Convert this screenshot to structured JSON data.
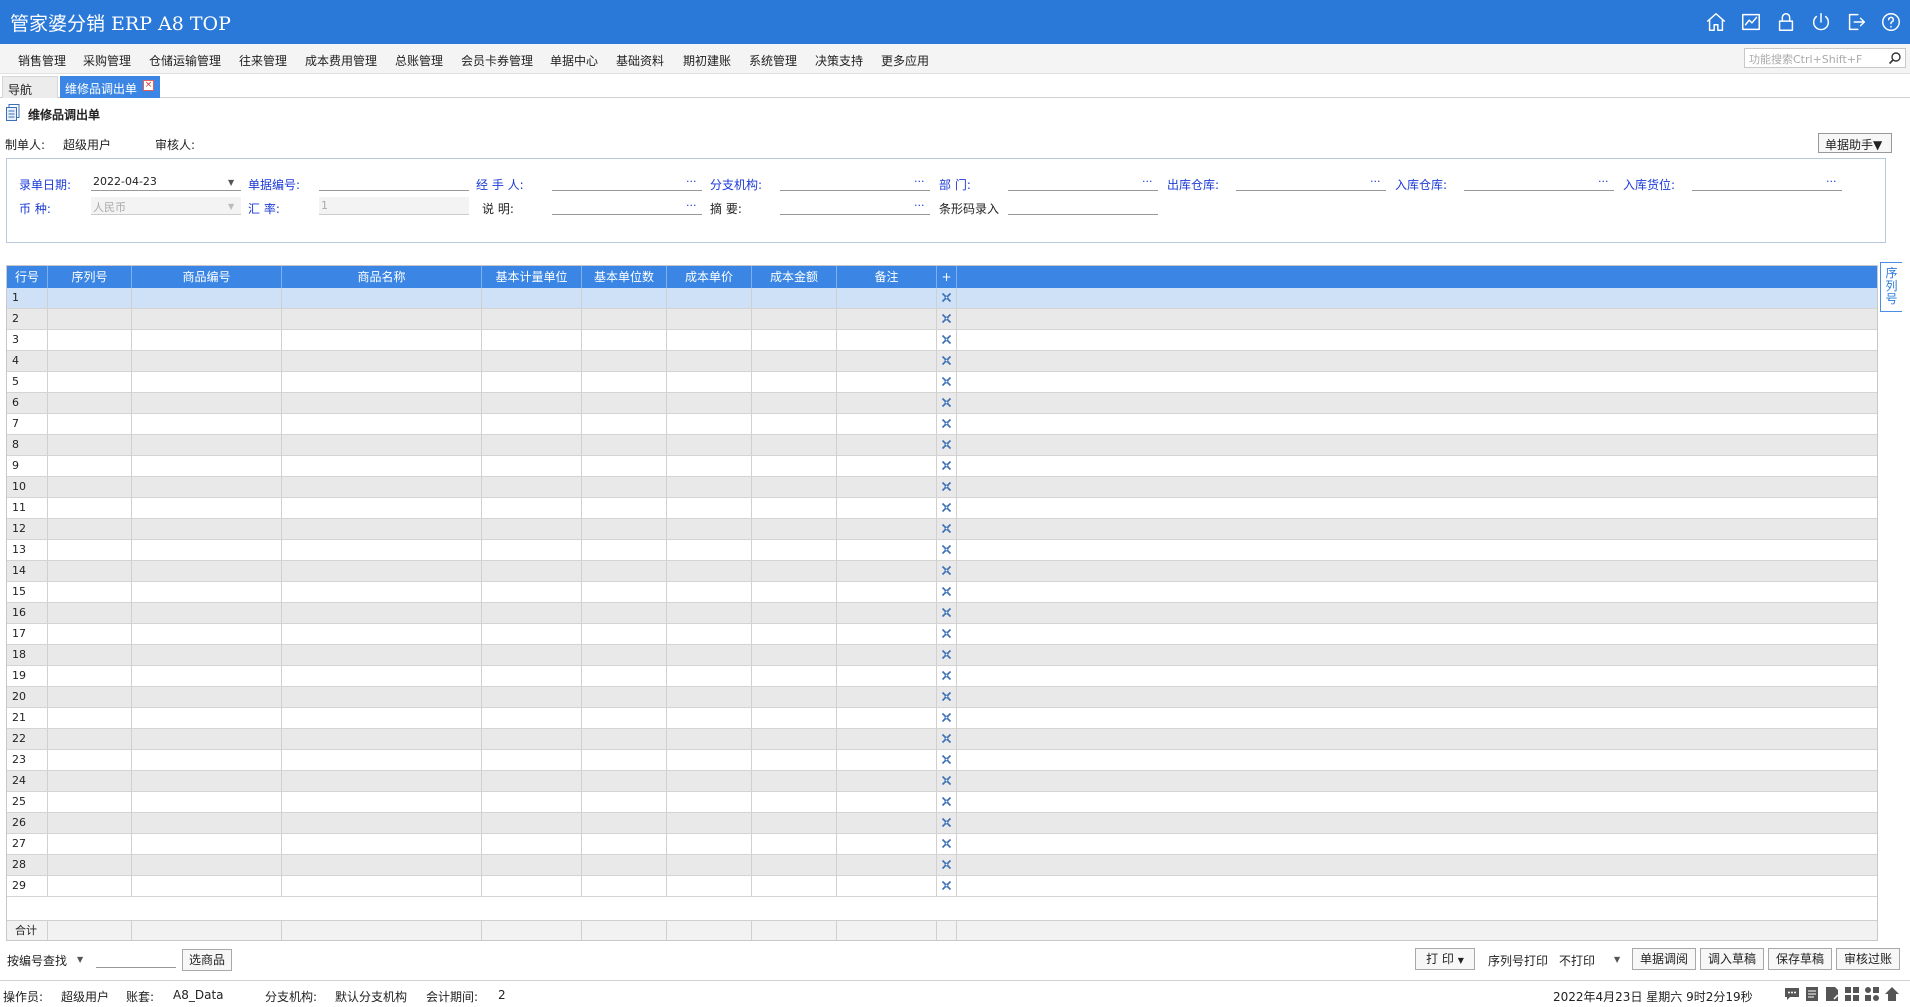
{
  "app": {
    "title": "管家婆分销 ERP A8 TOP"
  },
  "top_icons": [
    "home-icon",
    "chart-icon",
    "lock-icon",
    "power-icon",
    "logout-icon",
    "help-icon"
  ],
  "menu": [
    "销售管理",
    "采购管理",
    "仓储运输管理",
    "往来管理",
    "成本费用管理",
    "总账管理",
    "会员卡券管理",
    "单据中心",
    "基础资料",
    "期初建账",
    "系统管理",
    "决策支持",
    "更多应用"
  ],
  "function_search": {
    "placeholder": "功能搜索Ctrl+Shift+F"
  },
  "tabs": {
    "nav": "导航",
    "doc": "维修品调出单"
  },
  "page": {
    "title": "维修品调出单"
  },
  "meta": {
    "maker_label": "制单人:",
    "maker_value": "超级用户",
    "auditor_label": "审核人:",
    "auditor_value": ""
  },
  "helper_button": "单据助手▼",
  "form": {
    "date_label": "录单日期:",
    "date_value": "2022-04-23",
    "docno_label": "单据编号:",
    "docno_value": "",
    "handler_label": "经  手  人:",
    "handler_value": "",
    "branch_label": "分支机构:",
    "branch_value": "",
    "dept_label": "部    门:",
    "dept_value": "",
    "out_wh_label": "出库仓库:",
    "out_wh_value": "",
    "in_wh_label": "入库仓库:",
    "in_wh_value": "",
    "in_loc_label": "入库货位:",
    "in_loc_value": "",
    "currency_label": "币    种:",
    "currency_value": "人民币",
    "rate_label": "汇    率:",
    "rate_value": "1",
    "note_label": "说    明:",
    "note_value": "",
    "summary_label": "摘    要:",
    "summary_value": "",
    "barcode_label": "条形码录入",
    "barcode_value": ""
  },
  "grid": {
    "columns": [
      "行号",
      "序列号",
      "商品编号",
      "商品名称",
      "基本计量单位",
      "基本单位数",
      "成本单价",
      "成本金额",
      "备注",
      "+"
    ],
    "rows": [
      "1",
      "2",
      "3",
      "4",
      "5",
      "6",
      "7",
      "8",
      "9",
      "10",
      "11",
      "12",
      "13",
      "14",
      "15",
      "16",
      "17",
      "18",
      "19",
      "20",
      "21",
      "22",
      "23",
      "24",
      "25",
      "26",
      "27",
      "28",
      "29"
    ],
    "total_label": "合计",
    "selected_row": 1
  },
  "side_tab": "序列号",
  "search_bar": {
    "mode": "按编号查找",
    "value": "",
    "select_button": "选商品"
  },
  "bottom_buttons": {
    "print": "打 印",
    "serial_print_label": "序列号打印",
    "serial_print_value": "不打印",
    "retrieve": "单据调阅",
    "load_draft": "调入草稿",
    "save_draft": "保存草稿",
    "audit_post": "审核过账"
  },
  "status": {
    "operator_label": "操作员:",
    "operator": "超级用户",
    "account_label": "账套:",
    "account": "A8_Data",
    "branch_label": "分支机构:",
    "branch": "默认分支机构",
    "period_label": "会计期间:",
    "period": "2",
    "datetime": "2022年4月23日  星期六  9时2分19秒"
  },
  "status_icons": [
    "chat-icon",
    "notepad-icon",
    "document-icon",
    "grid-icon",
    "apps-icon",
    "home-up-icon"
  ],
  "colors": {
    "titlebar": "#2a78d8",
    "grid_header": "#3b86e4",
    "label_blue": "#1b3ad6",
    "row_selected": "#cfe1f7",
    "row_alt": "#e9e9e9"
  }
}
